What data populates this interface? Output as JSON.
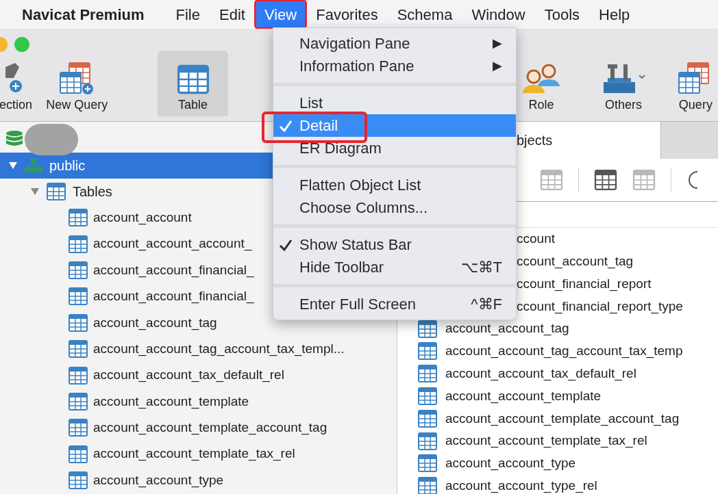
{
  "menubar": {
    "app": "Navicat Premium",
    "menus": [
      {
        "label": "File",
        "selected": false
      },
      {
        "label": "Edit",
        "selected": false
      },
      {
        "label": "View",
        "selected": true
      },
      {
        "label": "Favorites",
        "selected": false
      },
      {
        "label": "Schema",
        "selected": false
      },
      {
        "label": "Window",
        "selected": false
      },
      {
        "label": "Tools",
        "selected": false
      },
      {
        "label": "Help",
        "selected": false
      }
    ]
  },
  "toolbar": {
    "items": [
      {
        "kind": "connection",
        "label": "ection",
        "selected": false
      },
      {
        "kind": "query_new",
        "label": "New Query",
        "selected": false
      },
      {
        "kind": "table",
        "label": "Table",
        "selected": true
      },
      {
        "kind": "role",
        "label": "Role",
        "selected": false
      },
      {
        "kind": "others",
        "label": "Others",
        "selected": false
      },
      {
        "kind": "query",
        "label": "Query",
        "selected": false
      }
    ]
  },
  "view_menu": {
    "sections": [
      {
        "items": [
          {
            "label": "Navigation Pane",
            "checked": false,
            "highlighted": false,
            "arrow": "▶"
          },
          {
            "label": "Information Pane",
            "checked": false,
            "highlighted": false,
            "arrow": "▶"
          }
        ]
      },
      {
        "items": [
          {
            "label": "List",
            "checked": false,
            "highlighted": false
          },
          {
            "label": "Detail",
            "checked": true,
            "highlighted": true
          },
          {
            "label": "ER Diagram",
            "checked": false,
            "highlighted": false
          }
        ]
      },
      {
        "items": [
          {
            "label": "Flatten Object List",
            "checked": false,
            "highlighted": false
          },
          {
            "label": "Choose Columns...",
            "checked": false,
            "highlighted": false
          }
        ]
      },
      {
        "items": [
          {
            "label": "Show Status Bar",
            "checked": true,
            "highlighted": false
          },
          {
            "label": "Hide Toolbar",
            "checked": false,
            "highlighted": false,
            "shortcut": "⌥⌘T"
          }
        ]
      },
      {
        "items": [
          {
            "label": "Enter Full Screen",
            "checked": false,
            "highlighted": false,
            "shortcut": "^⌘F"
          }
        ]
      }
    ]
  },
  "navigation": {
    "tree": [
      {
        "expanded": true,
        "children": [
          {
            "label": "public",
            "expanded": true,
            "selected": true,
            "children": [
              {
                "label": "Tables",
                "expanded": true,
                "selected": false,
                "children": [
                  {
                    "label": "account_account",
                    "selected": false
                  },
                  {
                    "label": "account_account_account_",
                    "selected": false
                  },
                  {
                    "label": "account_account_financial_",
                    "selected": false
                  },
                  {
                    "label": "account_account_financial_",
                    "selected": false
                  },
                  {
                    "label": "account_account_tag",
                    "selected": false
                  },
                  {
                    "label": "account_account_tag_account_tax_templ...",
                    "selected": false
                  },
                  {
                    "label": "account_account_tax_default_rel",
                    "selected": false
                  },
                  {
                    "label": "account_account_template",
                    "selected": false
                  },
                  {
                    "label": "account_account_template_account_tag",
                    "selected": false
                  },
                  {
                    "label": "account_account_template_tax_rel",
                    "selected": false
                  },
                  {
                    "label": "account_account_type",
                    "selected": false
                  }
                ]
              }
            ]
          }
        ]
      }
    ]
  },
  "objects_pane": {
    "tab": "bjects",
    "items": [
      {
        "label": "ccount",
        "covered": true
      },
      {
        "label": "ccount_account_tag",
        "covered": true
      },
      {
        "label": "ccount_financial_report",
        "covered": true
      },
      {
        "label": "ccount_financial_report_type",
        "covered": true
      },
      {
        "label": "account_account_tag",
        "covered": false
      },
      {
        "label": "account_account_tag_account_tax_temp",
        "covered": false
      },
      {
        "label": "account_account_tax_default_rel",
        "covered": false
      },
      {
        "label": "account_account_template",
        "covered": false
      },
      {
        "label": "account_account_template_account_tag",
        "covered": false
      },
      {
        "label": "account_account_template_tax_rel",
        "covered": false
      },
      {
        "label": "account_account_type",
        "covered": false
      },
      {
        "label": "account_account_type_rel",
        "covered": false
      }
    ]
  }
}
